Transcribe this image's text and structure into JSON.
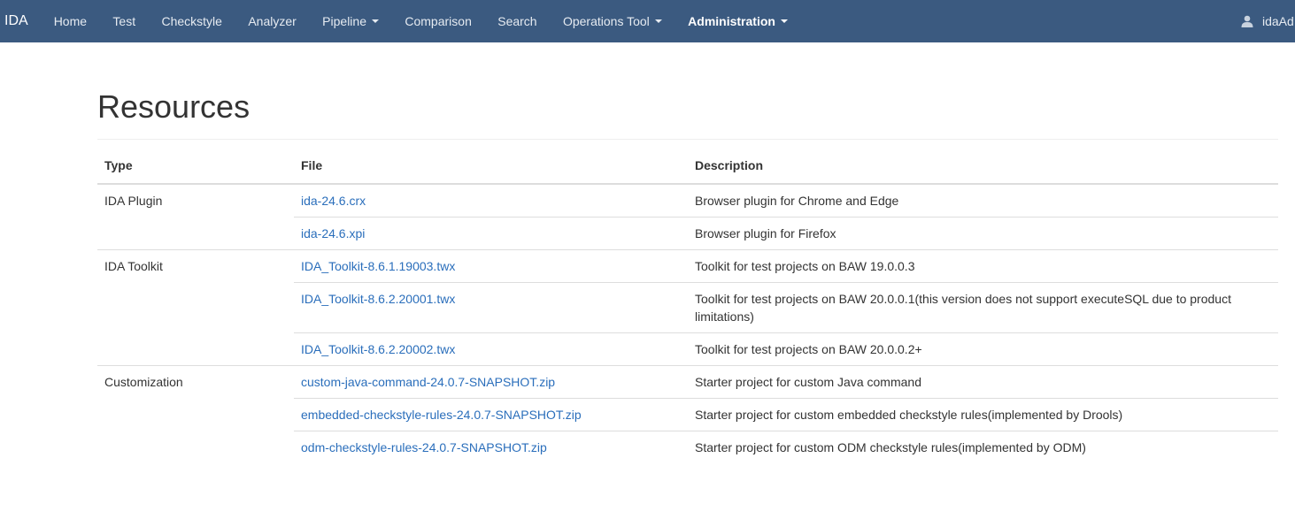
{
  "navbar": {
    "brand": "IDA",
    "items": [
      {
        "label": "Home",
        "dropdown": false,
        "active": false
      },
      {
        "label": "Test",
        "dropdown": false,
        "active": false
      },
      {
        "label": "Checkstyle",
        "dropdown": false,
        "active": false
      },
      {
        "label": "Analyzer",
        "dropdown": false,
        "active": false
      },
      {
        "label": "Pipeline",
        "dropdown": true,
        "active": false
      },
      {
        "label": "Comparison",
        "dropdown": false,
        "active": false
      },
      {
        "label": "Search",
        "dropdown": false,
        "active": false
      },
      {
        "label": "Operations Tool",
        "dropdown": true,
        "active": false
      },
      {
        "label": "Administration",
        "dropdown": true,
        "active": true
      }
    ],
    "user": {
      "name": "idaAd",
      "icon": "user-icon"
    },
    "color": "#3b5a80"
  },
  "page": {
    "title": "Resources"
  },
  "table": {
    "headers": {
      "type": "Type",
      "file": "File",
      "description": "Description"
    },
    "groups": [
      {
        "type": "IDA Plugin",
        "rows": [
          {
            "file": "ida-24.6.crx",
            "description": "Browser plugin for Chrome and Edge"
          },
          {
            "file": "ida-24.6.xpi",
            "description": "Browser plugin for Firefox"
          }
        ]
      },
      {
        "type": "IDA Toolkit",
        "rows": [
          {
            "file": "IDA_Toolkit-8.6.1.19003.twx",
            "description": "Toolkit for test projects on BAW 19.0.0.3"
          },
          {
            "file": "IDA_Toolkit-8.6.2.20001.twx",
            "description": "Toolkit for test projects on BAW 20.0.0.1(this version does not support executeSQL due to product limitations)"
          },
          {
            "file": "IDA_Toolkit-8.6.2.20002.twx",
            "description": "Toolkit for test projects on BAW 20.0.0.2+"
          }
        ]
      },
      {
        "type": "Customization",
        "rows": [
          {
            "file": "custom-java-command-24.0.7-SNAPSHOT.zip",
            "description": "Starter project for custom Java command"
          },
          {
            "file": "embedded-checkstyle-rules-24.0.7-SNAPSHOT.zip",
            "description": "Starter project for custom embedded checkstyle rules(implemented by Drools)"
          },
          {
            "file": "odm-checkstyle-rules-24.0.7-SNAPSHOT.zip",
            "description": "Starter project for custom ODM checkstyle rules(implemented by ODM)"
          }
        ]
      }
    ],
    "link_color": "#2a6ebb"
  }
}
